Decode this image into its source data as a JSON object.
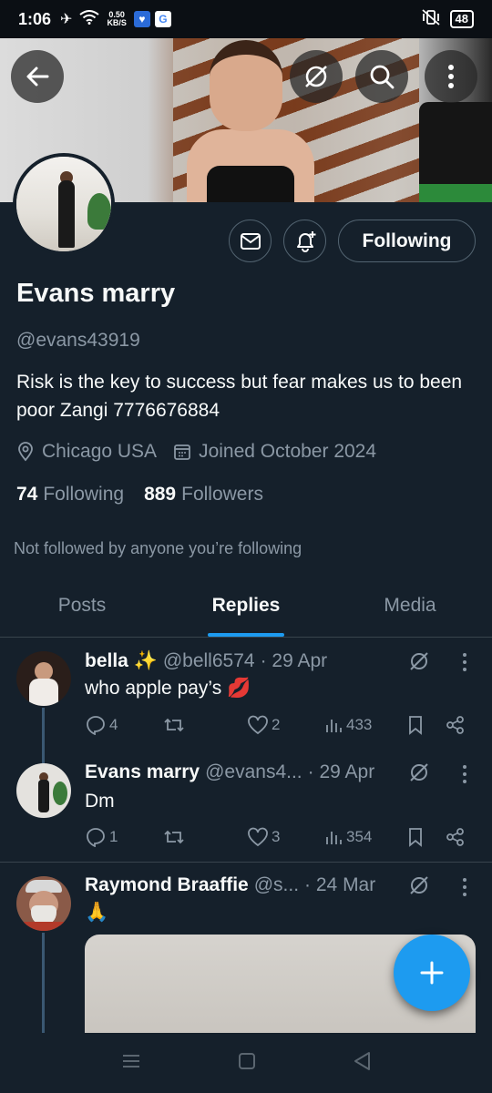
{
  "status_bar": {
    "time": "1:06",
    "speed_value": "0.50",
    "speed_unit": "KB/S",
    "battery": "48"
  },
  "profile": {
    "name": "Evans marry",
    "handle": "@evans43919",
    "bio": "Risk is the key to success but fear makes us to been poor Zangi 7776676884",
    "location": "Chicago USA",
    "joined": "Joined October 2024",
    "following_count": "74",
    "following_label": "Following",
    "followers_count": "889",
    "followers_label": "Followers",
    "not_followed_text": "Not followed by anyone you’re following",
    "follow_button_label": "Following"
  },
  "tabs": [
    {
      "label": "Posts",
      "active": false
    },
    {
      "label": "Replies",
      "active": true
    },
    {
      "label": "Media",
      "active": false
    }
  ],
  "posts": [
    {
      "name": "bella ✨",
      "handle": "@bell6574",
      "date": "· 29 Apr",
      "text": "who apple pay’s 💋",
      "replies": "4",
      "reposts": "",
      "likes": "2",
      "views": "433"
    },
    {
      "name": "Evans marry",
      "handle": "@evans4...",
      "date": "· 29 Apr",
      "text": "Dm",
      "replies": "1",
      "reposts": "",
      "likes": "3",
      "views": "354"
    },
    {
      "name": "Raymond Braaffie",
      "handle": "@s...",
      "date": "· 24 Mar",
      "text": "🙏"
    }
  ],
  "colors": {
    "background": "#15202b",
    "accent": "#1d9bf0",
    "secondary_text": "#8b98a5",
    "border": "#536471"
  }
}
